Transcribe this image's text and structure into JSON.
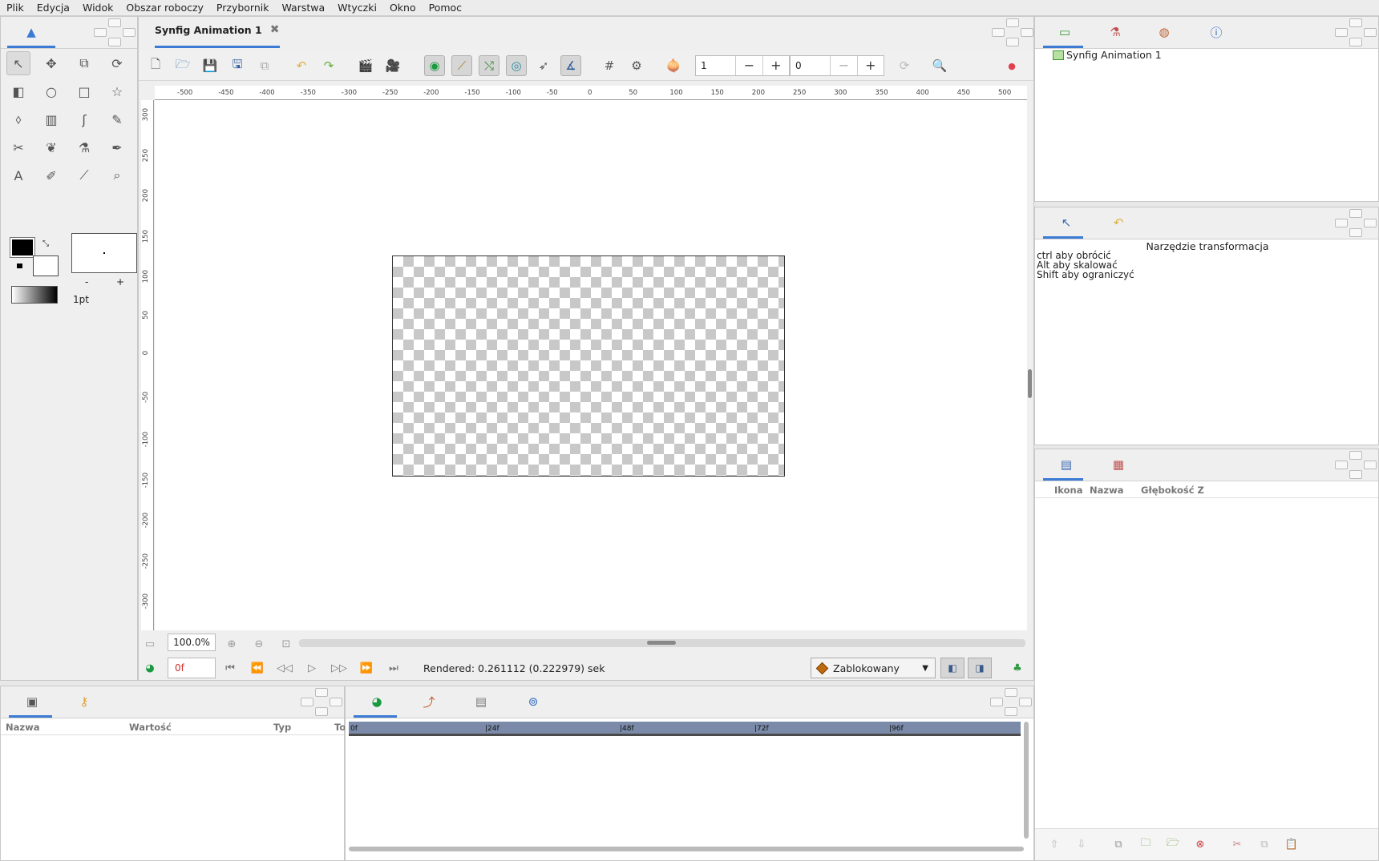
{
  "menu": [
    "Plik",
    "Edycja",
    "Widok",
    "Obszar roboczy",
    "Przybornik",
    "Warstwa",
    "Wtyczki",
    "Okno",
    "Pomoc"
  ],
  "toolbox": {
    "tools": [
      {
        "name": "transform-tool",
        "icon": "↖"
      },
      {
        "name": "smooth-move-tool",
        "icon": "✥"
      },
      {
        "name": "scale-tool",
        "icon": "⧉"
      },
      {
        "name": "rotate-tool",
        "icon": "⟳"
      },
      {
        "name": "mirror-tool",
        "icon": "◧"
      },
      {
        "name": "circle-tool",
        "icon": "○"
      },
      {
        "name": "rectangle-tool",
        "icon": "□"
      },
      {
        "name": "star-tool",
        "icon": "☆"
      },
      {
        "name": "fill-tool",
        "icon": "⬨"
      },
      {
        "name": "gradient-tool",
        "icon": "▥"
      },
      {
        "name": "spline-tool",
        "icon": "ʃ"
      },
      {
        "name": "draw-tool",
        "icon": "✎"
      },
      {
        "name": "cutout-tool",
        "icon": "✂"
      },
      {
        "name": "width-tool",
        "icon": "❦"
      },
      {
        "name": "eyedropper-tool",
        "icon": "⚗"
      },
      {
        "name": "brush-tool",
        "icon": "✒"
      },
      {
        "name": "text-tool",
        "icon": "A"
      },
      {
        "name": "sketch-tool",
        "icon": "✐"
      },
      {
        "name": "bone-tool",
        "icon": "⟋"
      },
      {
        "name": "zoom-tool",
        "icon": "⌕"
      }
    ],
    "brush_size": "1pt",
    "minus": "-",
    "plus": "+"
  },
  "document": {
    "tab_title": "Synfig Animation 1",
    "close_icon": "✖",
    "zoom": "100.0%",
    "current_frame": "0f",
    "rendered": "Rendered: 0.261112 (0.222979) sek",
    "lock_mode": "Zablokowany",
    "onion_past": "1",
    "onion_future": "0",
    "minus": "−",
    "plus": "+"
  },
  "ruler": {
    "h": [
      "-500",
      "-450",
      "-400",
      "-350",
      "-300",
      "-250",
      "-200",
      "-150",
      "-100",
      "-50",
      "0",
      "50",
      "100",
      "150",
      "200",
      "250",
      "300",
      "350",
      "400",
      "450",
      "500"
    ],
    "v": [
      "300",
      "250",
      "200",
      "150",
      "100",
      "50",
      "0",
      "-50",
      "-100",
      "-150",
      "-200",
      "-250",
      "-300"
    ]
  },
  "canvas_browser": {
    "item": "Synfig Animation 1"
  },
  "tool_options": {
    "title": "Narzędzie transformacja",
    "lines": [
      "ctrl aby obrócić",
      "Alt aby skalować",
      "Shift aby ograniczyć"
    ]
  },
  "layers": {
    "cols": [
      "Ikona",
      "Nazwa",
      "Głębokość Z"
    ]
  },
  "params": {
    "cols": [
      "Nazwa",
      "Wartość",
      "Typ",
      "To"
    ]
  },
  "timetrack": {
    "marks": [
      "0f",
      "|24f",
      "|48f",
      "|72f",
      "|96f"
    ]
  },
  "colors": {
    "accent": "#3b7bd4",
    "frame_text": "#d03030",
    "time_bar": "#7a8aa8"
  }
}
